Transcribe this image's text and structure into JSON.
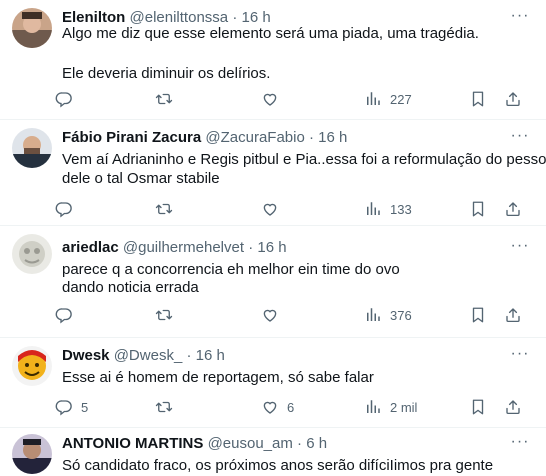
{
  "tweets": [
    {
      "name": "Elenilton",
      "handle": "@elenilttonssa",
      "time": "16 h",
      "lines": [
        "Algo me diz que esse elemento será uma piada, uma tragédia.",
        "",
        "Ele deveria diminuir os delírios."
      ],
      "reply_count": "",
      "retweet_count": "",
      "like_count": "",
      "views": "227"
    },
    {
      "name": "Fábio Pirani Zacura",
      "handle": "@ZacuraFabio",
      "time": "16 h",
      "lines": [
        "Vem aí Adrianinho e Regis pitbul e Pia..essa foi a reformulação do pessoal",
        "dele o tal Osmar stabile"
      ],
      "reply_count": "",
      "retweet_count": "",
      "like_count": "",
      "views": "133"
    },
    {
      "name": "ariedlac",
      "handle": "@guilhermehelvet",
      "time": "16 h",
      "lines": [
        "parece q a concorrencia eh melhor ein time do ovo",
        "dando noticia errada"
      ],
      "reply_count": "",
      "retweet_count": "",
      "like_count": "",
      "views": "376"
    },
    {
      "name": "Dwesk",
      "handle": "@Dwesk_",
      "time": "16 h",
      "lines": [
        "Esse ai é homem de reportagem, só sabe falar"
      ],
      "reply_count": "5",
      "retweet_count": "",
      "like_count": "6",
      "views": "2 mil"
    },
    {
      "name": "ANTONIO MARTINS",
      "handle": "@eusou_am",
      "time": "6 h",
      "lines": [
        "Só candidato fraco, os próximos anos serão difíciIimos pra gente"
      ],
      "reply_count": "",
      "retweet_count": "",
      "like_count": "",
      "views": ""
    }
  ],
  "dot": "·",
  "more_glyph": "···",
  "icons": [
    "reply-icon",
    "retweet-icon",
    "like-icon",
    "views-icon",
    "bookmark-icon",
    "share-icon",
    "more-icon"
  ],
  "colors": {
    "text": "#0f1419",
    "secondary": "#536471",
    "divider": "#eff3f4"
  }
}
